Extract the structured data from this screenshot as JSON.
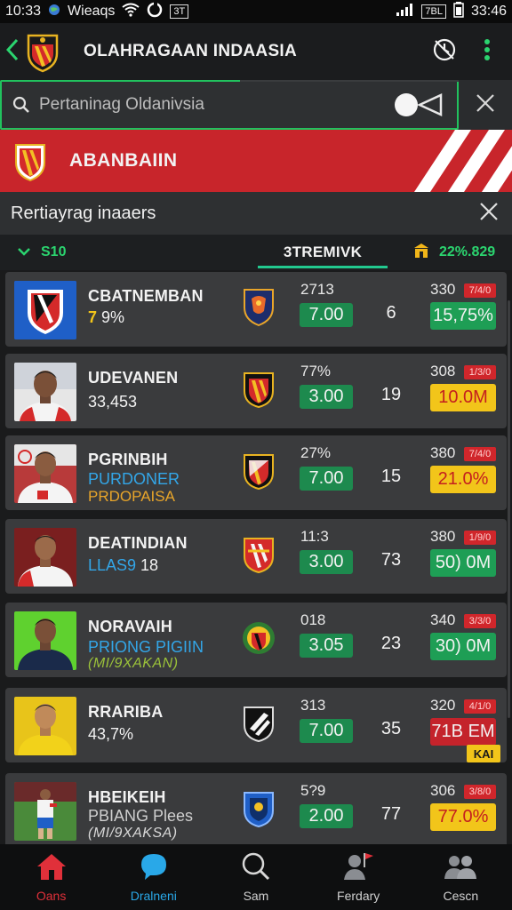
{
  "status_bar": {
    "time": "10:33",
    "carrier": "Wieaqs",
    "box_label": "3T",
    "battery_label": "7BL",
    "clock": "33:46"
  },
  "app_bar": {
    "title": "OLAHRAGAAN INDAASIA"
  },
  "search": {
    "placeholder": "Pertaninag Oldanivsia"
  },
  "banner": {
    "title": "ABANBAIIN"
  },
  "section": {
    "title": "Rertiayrag inaaers"
  },
  "tabs": {
    "left_label": "S10",
    "center_label": "3TREMIVK",
    "right_label": "22%.829"
  },
  "colors": {
    "accent_green": "#21c25e",
    "banner_red": "#c8252b",
    "price_yellow": "#f2c51a"
  },
  "players": [
    {
      "name": "CBATNEMBAN",
      "sub1_prefix": "7",
      "sub1": " 9%",
      "sub2": "",
      "pct": "2713",
      "value": "7.00",
      "count": "6",
      "small_num": "330",
      "red_tag": "7/4/0",
      "price": "15,75%",
      "price_style": "green",
      "extra_tag": ""
    },
    {
      "name": "UDEVANEN",
      "sub1_prefix": "",
      "sub1": "33,453",
      "sub2": "",
      "pct": "77%",
      "value": "3.00",
      "count": "19",
      "small_num": "308",
      "red_tag": "1/3/0",
      "price": "10.0M",
      "price_style": "yellow",
      "extra_tag": ""
    },
    {
      "name": "PGRINBIH",
      "sub1_prefix": "",
      "sub1": "PURDONER",
      "sub2": "PRDOPAISA",
      "pct": "27%",
      "value": "7.00",
      "count": "15",
      "small_num": "380",
      "red_tag": "7/4/0",
      "price": "21.0%",
      "price_style": "yellow",
      "extra_tag": ""
    },
    {
      "name": "DEATINDIAN",
      "sub1_prefix": "",
      "sub1": "LLAS9",
      "sub1_suffix": " 18",
      "sub2": "",
      "pct": "11:3",
      "value": "3.00",
      "count": "73",
      "small_num": "380",
      "red_tag": "1/9/0",
      "price": "50) 0M",
      "price_style": "green",
      "extra_tag": ""
    },
    {
      "name": "NORAVAIH",
      "sub1_prefix": "",
      "sub1": "PRIONG PIGIIN",
      "sub2": "(MI/9XAKAN)",
      "pct": "018",
      "value": "3.05",
      "count": "23",
      "small_num": "340",
      "red_tag": "3/3/0",
      "price": "30) 0M",
      "price_style": "green",
      "extra_tag": ""
    },
    {
      "name": "RRARIBA",
      "sub1_prefix": "",
      "sub1": "43,7%",
      "sub2": "",
      "pct": "313",
      "value": "7.00",
      "count": "35",
      "small_num": "320",
      "red_tag": "4/1/0",
      "price": "71B EM",
      "price_style": "red",
      "extra_tag": "KAI"
    },
    {
      "name": "HBEIKEIH",
      "sub1_prefix": "",
      "sub1": "PBIANG Plees",
      "sub2": "(MI/9XAKSA)",
      "pct": "5?9",
      "value": "2.00",
      "count": "77",
      "small_num": "306",
      "red_tag": "3/8/0",
      "price": "77.0%",
      "price_style": "yellow",
      "extra_tag": ""
    }
  ],
  "bottom_nav": [
    {
      "label": "Oans",
      "icon": "home-icon"
    },
    {
      "label": "Dralneni",
      "icon": "chat-icon"
    },
    {
      "label": "Sam",
      "icon": "search-icon"
    },
    {
      "label": "Ferdary",
      "icon": "user-flag-icon"
    },
    {
      "label": "Cescn",
      "icon": "group-icon"
    }
  ]
}
